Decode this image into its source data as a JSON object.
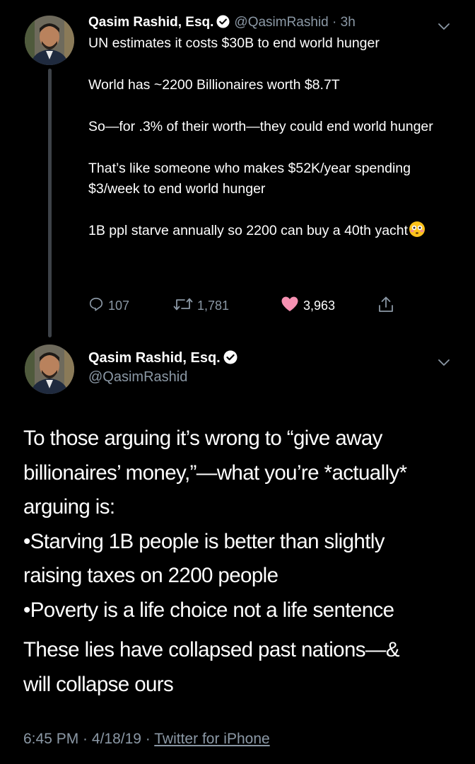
{
  "tweet1": {
    "author_name": "Qasim Rashid, Esq.",
    "handle": "@QasimRashid",
    "separator": " · ",
    "time_ago": "3h",
    "paragraphs": [
      "UN estimates it costs $30B to end world hunger",
      "World has ~2200 Billionaires worth $8.7T",
      "So—for .3% of their worth—they could end world hunger",
      "That’s like someone who makes $52K/year spending $3/week to end world hunger",
      "1B ppl starve annually so 2200 can buy a 40th yacht"
    ],
    "emoji": "flushed-face-emoji",
    "replies": "107",
    "retweets": "1,781",
    "likes": "3,963"
  },
  "tweet2": {
    "author_name": "Qasim Rashid, Esq.",
    "handle": "@QasimRashid",
    "body_para1": [
      "To those arguing it’s wrong to “give away",
      "billionaires’ money,”—what you’re *actually*",
      "arguing is:",
      "•Starving 1B people is better than slightly",
      "raising taxes on 2200 people",
      "•Poverty is a life choice not a life sentence"
    ],
    "body_para2": [
      "These lies have collapsed past nations—&",
      "will collapse ours"
    ],
    "time": "6:45 PM",
    "date": "4/18/19",
    "separator": " · ",
    "source": "Twitter for iPhone"
  },
  "icons": {
    "verified": "verified-badge-icon",
    "caret": "chevron-down-icon",
    "reply": "reply-icon",
    "retweet": "retweet-icon",
    "like": "heart-icon",
    "share": "share-icon"
  },
  "colors": {
    "background": "#000000",
    "text": "#ffffff",
    "muted": "#8b98a5",
    "like": "#f691b2",
    "thread_line": "#3d4248"
  }
}
